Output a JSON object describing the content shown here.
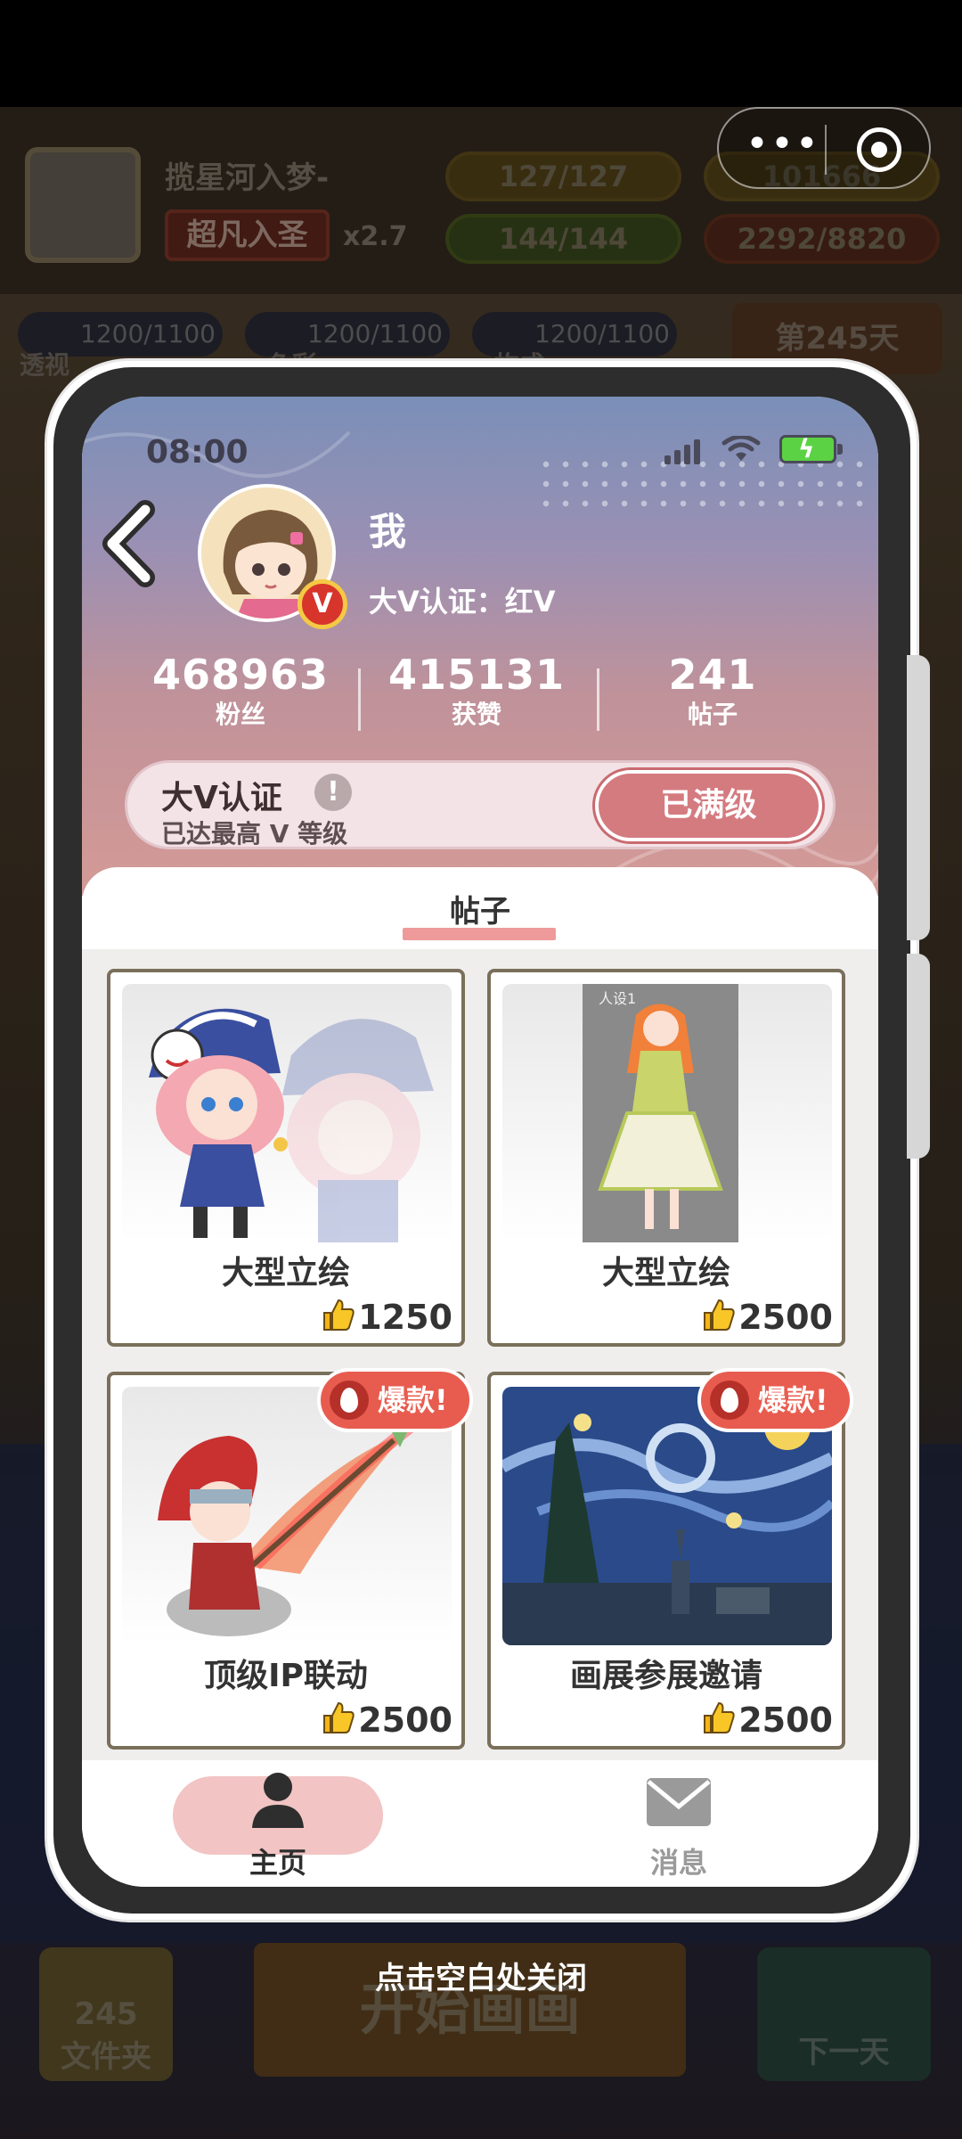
{
  "background": {
    "player_name": "揽星河入梦-",
    "rank": "超凡入圣",
    "multiplier": "x2.7",
    "energy": "127/127",
    "coins": "101666",
    "health": "144/144",
    "ideas": "2292/8820",
    "stats": [
      {
        "label": "透视",
        "value": "1200/1100"
      },
      {
        "label": "色彩",
        "value": "1200/1100"
      },
      {
        "label": "构成",
        "value": "1200/1100"
      }
    ],
    "day": "第245天",
    "folder_count": "245",
    "folder_label": "文件夹",
    "start_label": "开始画画",
    "next_day_label": "下一天"
  },
  "status_bar": {
    "time": "08:00"
  },
  "profile": {
    "name": "我",
    "certification": "大V认证：红V",
    "badge": "V",
    "stats": [
      {
        "value": "468963",
        "label": "粉丝"
      },
      {
        "value": "415131",
        "label": "获赞"
      },
      {
        "value": "241",
        "label": "帖子"
      }
    ],
    "v_panel": {
      "title": "大V认证",
      "info_icon": "!",
      "subtitle": "已达最高 V 等级",
      "button": "已满级"
    }
  },
  "posts": {
    "tab_label": "帖子",
    "hot_label": "爆款!",
    "items": [
      {
        "title": "大型立绘",
        "likes": "1250",
        "hot": false,
        "art": "jester-girl"
      },
      {
        "title": "大型立绘",
        "likes": "2500",
        "hot": false,
        "art": "orange-hair-dress",
        "art_caption": "人设1"
      },
      {
        "title": "顶级IP联动",
        "likes": "2500",
        "hot": true,
        "art": "red-hair-spear"
      },
      {
        "title": "画展参展邀请",
        "likes": "2500",
        "hot": true,
        "art": "starry-night"
      }
    ]
  },
  "nav": {
    "home": "主页",
    "messages": "消息"
  },
  "close_hint": "点击空白处关闭",
  "colors": {
    "accent_pink": "#d47b80",
    "hot_red": "#e85c4f",
    "tab_underline": "#ef9a9a"
  }
}
